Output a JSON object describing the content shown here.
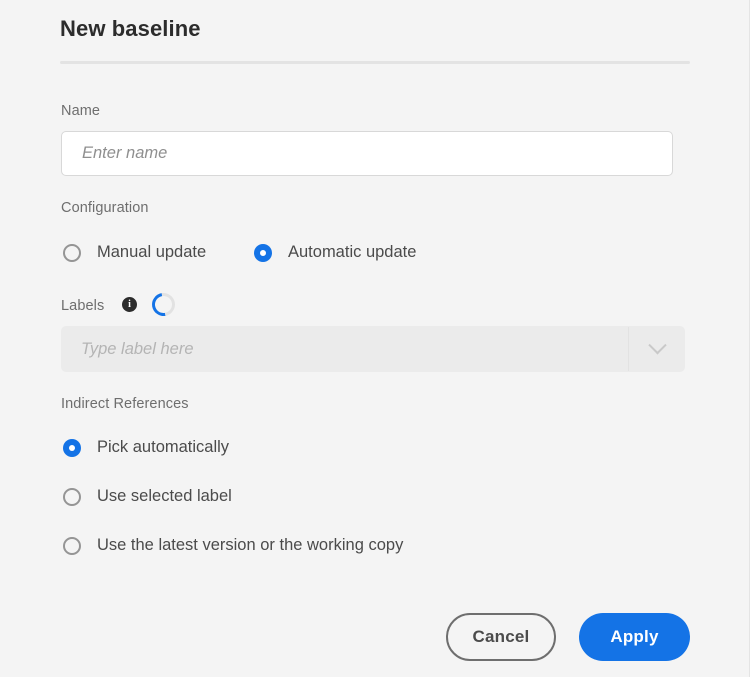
{
  "dialog": {
    "title": "New baseline"
  },
  "name_field": {
    "label": "Name",
    "placeholder": "Enter name",
    "value": ""
  },
  "configuration": {
    "label": "Configuration",
    "options": [
      {
        "label": "Manual update",
        "selected": false
      },
      {
        "label": "Automatic update",
        "selected": true
      }
    ]
  },
  "labels_field": {
    "label": "Labels",
    "info_icon": "info-icon",
    "loading_icon": "loading-spinner-icon",
    "placeholder": "Type label here",
    "value": "",
    "dropdown_icon": "chevron-down-icon",
    "disabled": true
  },
  "indirect_references": {
    "label": "Indirect References",
    "options": [
      {
        "label": "Pick automatically",
        "selected": true
      },
      {
        "label": "Use selected label",
        "selected": false
      },
      {
        "label": "Use the latest version or the working copy",
        "selected": false
      }
    ]
  },
  "footer": {
    "cancel_label": "Cancel",
    "apply_label": "Apply"
  },
  "colors": {
    "accent": "#1473e6",
    "background": "#f4f4f4",
    "title_text": "#2c2c2c",
    "label_text": "#6e6e6e",
    "option_text": "#4b4b4b",
    "placeholder_text": "#8f8f8f",
    "disabled_field": "#ebebeb"
  }
}
